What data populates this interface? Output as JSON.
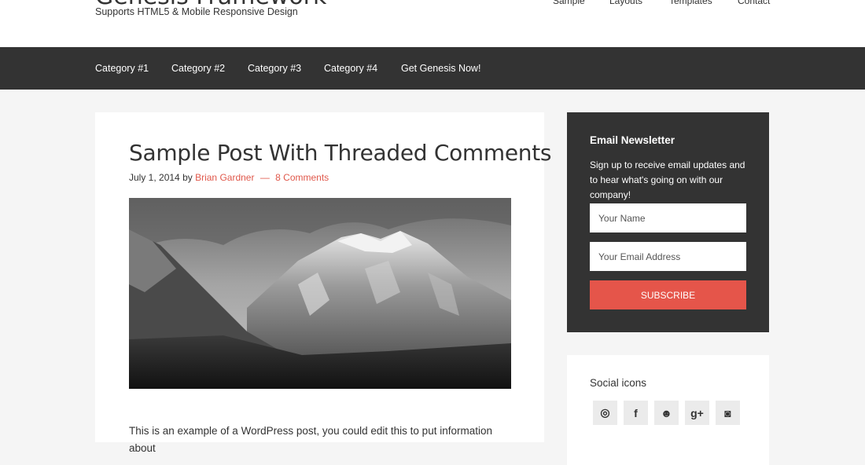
{
  "header": {
    "site_title": "Genesis Framework",
    "site_description": "Supports HTML5 & Mobile Responsive Design",
    "nav": [
      "Sample",
      "Layouts",
      "Templates",
      "Contact"
    ]
  },
  "primary_nav": [
    "Category #1",
    "Category #2",
    "Category #3",
    "Category #4",
    "Get Genesis Now!"
  ],
  "post": {
    "title": "Sample Post With Threaded Comments",
    "date": "July 1, 2014",
    "by": "by",
    "author": "Brian Gardner",
    "separator": "—",
    "comments": "8 Comments",
    "excerpt": "This is an example of a WordPress post, you could edit this to put information about"
  },
  "newsletter": {
    "title": "Email Newsletter",
    "text": "Sign up to receive email updates and to hear what's going on with our company!",
    "name_placeholder": "Your Name",
    "email_placeholder": "Your Email Address",
    "subscribe_label": "Subscribe"
  },
  "social": {
    "title": "Social icons",
    "icons": [
      "dribbble-icon",
      "facebook-icon",
      "github-icon",
      "google-plus-icon",
      "instagram-icon"
    ],
    "glyphs": [
      "◎",
      "f",
      "☻",
      "g+",
      "◙"
    ]
  },
  "colors": {
    "accent": "#e5554a",
    "dark": "#333333",
    "background": "#f5f5f5"
  }
}
